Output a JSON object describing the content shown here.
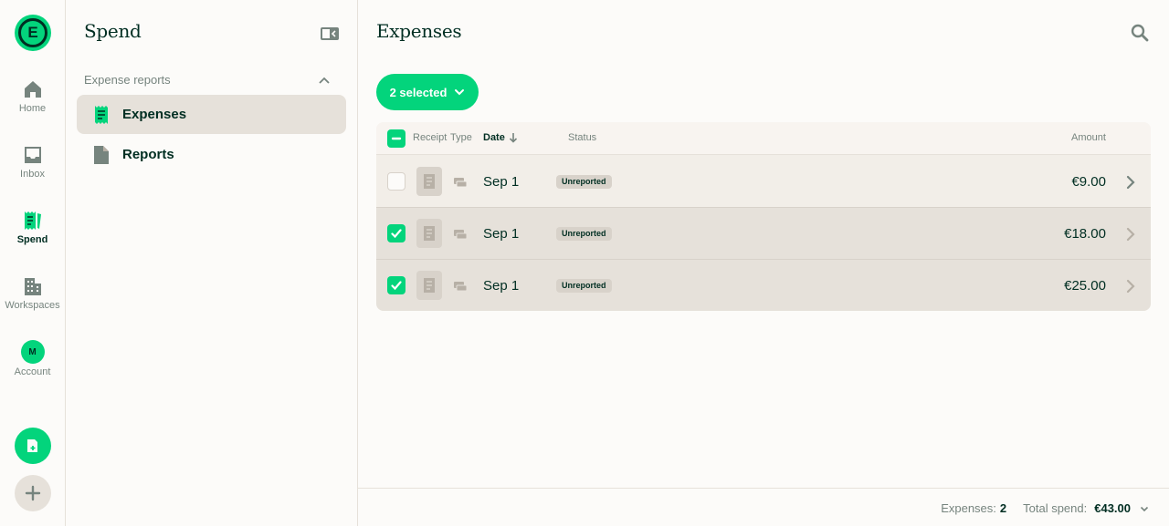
{
  "rail": {
    "items": [
      {
        "label": "Home",
        "icon": "home-icon"
      },
      {
        "label": "Inbox",
        "icon": "inbox-icon"
      },
      {
        "label": "Spend",
        "icon": "receipt-icon"
      },
      {
        "label": "Workspaces",
        "icon": "building-icon"
      },
      {
        "label": "Account",
        "icon": "avatar"
      }
    ],
    "logo_letter": "E",
    "avatar_initial": "M"
  },
  "sidebar": {
    "title": "Spend",
    "section_label": "Expense reports",
    "items": [
      {
        "label": "Expenses",
        "icon": "receipt-icon"
      },
      {
        "label": "Reports",
        "icon": "document-icon"
      }
    ]
  },
  "main": {
    "title": "Expenses",
    "selection_button": "2 selected",
    "columns": {
      "receipt": "Receipt",
      "type": "Type",
      "date": "Date",
      "status": "Status",
      "amount": "Amount"
    },
    "rows": [
      {
        "checked": false,
        "date": "Sep 1",
        "status": "Unreported",
        "amount": "€9.00"
      },
      {
        "checked": true,
        "date": "Sep 1",
        "status": "Unreported",
        "amount": "€18.00"
      },
      {
        "checked": true,
        "date": "Sep 1",
        "status": "Unreported",
        "amount": "€25.00"
      }
    ]
  },
  "footer": {
    "expenses_label": "Expenses:",
    "expenses_count": "2",
    "total_label": "Total spend:",
    "total_value": "€43.00"
  },
  "colors": {
    "accent": "#03d47c",
    "text": "#002e22",
    "muted": "#76847e",
    "background": "#fcfbf9",
    "highlight": "#e6e1da"
  }
}
